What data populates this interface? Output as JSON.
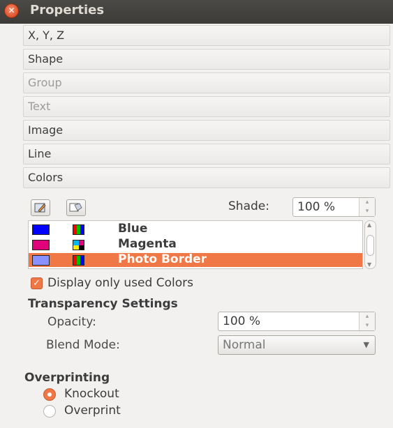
{
  "window": {
    "title": "Properties",
    "close_glyph": "✕"
  },
  "sections": [
    {
      "label": "X, Y, Z",
      "enabled": true
    },
    {
      "label": "Shape",
      "enabled": true
    },
    {
      "label": "Group",
      "enabled": false
    },
    {
      "label": "Text",
      "enabled": false
    },
    {
      "label": "Image",
      "enabled": true
    },
    {
      "label": "Line",
      "enabled": true
    },
    {
      "label": "Colors",
      "enabled": true
    }
  ],
  "colors": {
    "tool_icons": [
      "edit-stroke-color-icon",
      "edit-fill-color-icon"
    ],
    "shade_label": "Shade:",
    "shade_value": "100 %",
    "list": [
      {
        "name": "Blue",
        "swatch": "#0000ff",
        "selected": false
      },
      {
        "name": "Magenta",
        "swatch": "#e0007a",
        "selected": false
      },
      {
        "name": "Photo Border",
        "swatch": "#8a90ff",
        "selected": true
      }
    ],
    "display_only_used_label": "Display only used Colors",
    "display_only_used_checked": true
  },
  "transparency": {
    "title": "Transparency Settings",
    "opacity_label": "Opacity:",
    "opacity_value": "100 %",
    "blend_label": "Blend Mode:",
    "blend_value": "Normal"
  },
  "overprinting": {
    "title": "Overprinting",
    "options": [
      {
        "label": "Knockout",
        "selected": true
      },
      {
        "label": "Overprint",
        "selected": false
      }
    ]
  },
  "theme": {
    "accent": "#f07746",
    "titlebar": "#3c3b37"
  }
}
